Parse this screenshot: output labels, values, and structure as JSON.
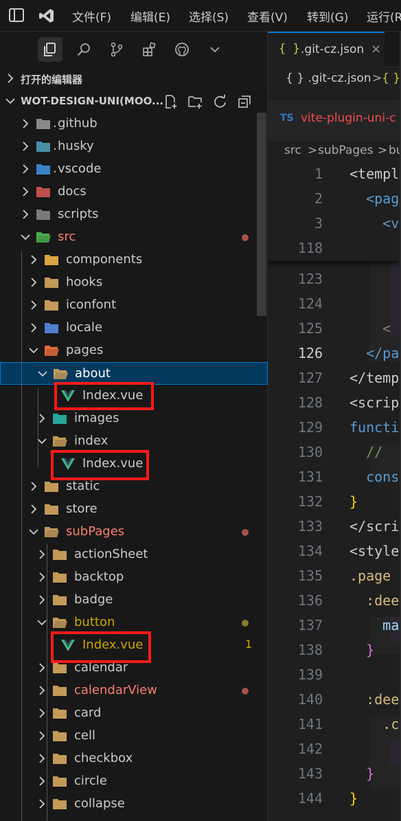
{
  "menu": {
    "items": [
      "文件(F)",
      "编辑(E)",
      "选择(S)",
      "查看(V)",
      "转到(G)",
      "运行(R)"
    ]
  },
  "activity_icons": [
    "explorer-icon",
    "search-icon",
    "source-control-icon",
    "extensions-icon",
    "github-icon",
    "chevron-down-icon"
  ],
  "explorer": {
    "open_editors_label": "打开的编辑器",
    "project_label": "WOT-DESIGN-UNI(MOO...",
    "rows": [
      {
        "label": "github",
        "prefix": ".",
        "depth": 0,
        "expanded": false,
        "icon": "github-folder-icon",
        "color": "#cccccc"
      },
      {
        "label": "husky",
        "prefix": ".",
        "depth": 0,
        "expanded": false,
        "icon": "husky-folder-icon",
        "color": "#cccccc"
      },
      {
        "label": "vscode",
        "prefix": ".",
        "depth": 0,
        "expanded": false,
        "icon": "vscode-folder-icon",
        "color": "#cccccc"
      },
      {
        "label": "docs",
        "prefix": "",
        "depth": 0,
        "expanded": false,
        "icon": "docs-folder-icon",
        "color": "#cccccc"
      },
      {
        "label": "scripts",
        "prefix": "",
        "depth": 0,
        "expanded": false,
        "icon": "scripts-folder-icon",
        "color": "#cccccc"
      },
      {
        "label": "src",
        "prefix": "",
        "depth": 0,
        "expanded": true,
        "icon": "src-folder-icon",
        "color": "#f88070",
        "dot": "#a4524a"
      },
      {
        "label": "components",
        "prefix": "",
        "depth": 1,
        "expanded": false,
        "icon": "components-folder-icon",
        "color": "#cccccc"
      },
      {
        "label": "hooks",
        "prefix": "",
        "depth": 1,
        "expanded": false,
        "icon": "hooks-folder-icon",
        "color": "#cccccc"
      },
      {
        "label": "iconfont",
        "prefix": "",
        "depth": 1,
        "expanded": false,
        "icon": "folder-icon",
        "color": "#cccccc"
      },
      {
        "label": "locale",
        "prefix": "",
        "depth": 1,
        "expanded": false,
        "icon": "locale-folder-icon",
        "color": "#cccccc"
      },
      {
        "label": "pages",
        "prefix": "",
        "depth": 1,
        "expanded": true,
        "icon": "pages-folder-icon",
        "color": "#cccccc"
      },
      {
        "label": "about",
        "prefix": "",
        "depth": 2,
        "expanded": true,
        "icon": "folder-open-icon",
        "color": "#ffffff",
        "selected": true
      },
      {
        "label": "Index.vue",
        "prefix": "",
        "depth": 3,
        "file": true,
        "icon": "vue-file-icon",
        "color": "#cccccc",
        "boxed": true
      },
      {
        "label": "images",
        "prefix": "",
        "depth": 2,
        "expanded": false,
        "icon": "images-folder-icon",
        "color": "#cccccc"
      },
      {
        "label": "index",
        "prefix": "",
        "depth": 2,
        "expanded": true,
        "icon": "folder-open-icon",
        "color": "#cccccc"
      },
      {
        "label": "Index.vue",
        "prefix": "",
        "depth": 3,
        "file": true,
        "icon": "vue-file-icon",
        "color": "#cccccc",
        "boxed": true
      },
      {
        "label": "static",
        "prefix": "",
        "depth": 1,
        "expanded": false,
        "icon": "folder-icon",
        "color": "#cccccc"
      },
      {
        "label": "store",
        "prefix": "",
        "depth": 1,
        "expanded": false,
        "icon": "folder-icon",
        "color": "#cccccc"
      },
      {
        "label": "subPages",
        "prefix": "",
        "depth": 1,
        "expanded": true,
        "icon": "folder-open-icon",
        "color": "#f88070",
        "dot": "#a4524a"
      },
      {
        "label": "actionSheet",
        "prefix": "",
        "depth": 2,
        "expanded": false,
        "icon": "folder-icon",
        "color": "#cccccc"
      },
      {
        "label": "backtop",
        "prefix": "",
        "depth": 2,
        "expanded": false,
        "icon": "folder-icon",
        "color": "#cccccc"
      },
      {
        "label": "badge",
        "prefix": "",
        "depth": 2,
        "expanded": false,
        "icon": "folder-icon",
        "color": "#cccccc"
      },
      {
        "label": "button",
        "prefix": "",
        "depth": 2,
        "expanded": true,
        "icon": "folder-open-icon",
        "color": "#cca700",
        "dot": "#8a7a2e"
      },
      {
        "label": "Index.vue",
        "prefix": "",
        "depth": 3,
        "file": true,
        "icon": "vue-file-icon",
        "color": "#cca700",
        "boxed": true,
        "badge": "1"
      },
      {
        "label": "calendar",
        "prefix": "",
        "depth": 2,
        "expanded": false,
        "icon": "folder-icon",
        "color": "#cccccc"
      },
      {
        "label": "calendarView",
        "prefix": "",
        "depth": 2,
        "expanded": false,
        "icon": "folder-icon",
        "color": "#f88070",
        "dot": "#a4524a"
      },
      {
        "label": "card",
        "prefix": "",
        "depth": 2,
        "expanded": false,
        "icon": "folder-icon",
        "color": "#cccccc"
      },
      {
        "label": "cell",
        "prefix": "",
        "depth": 2,
        "expanded": false,
        "icon": "folder-icon",
        "color": "#cccccc"
      },
      {
        "label": "checkbox",
        "prefix": "",
        "depth": 2,
        "expanded": false,
        "icon": "folder-icon",
        "color": "#cccccc"
      },
      {
        "label": "circle",
        "prefix": "",
        "depth": 2,
        "expanded": false,
        "icon": "folder-icon",
        "color": "#cccccc"
      },
      {
        "label": "collapse",
        "prefix": "",
        "depth": 2,
        "expanded": false,
        "icon": "folder-icon",
        "color": "#cccccc"
      }
    ]
  },
  "editor": {
    "tab_icon": "{ }",
    "tab_title": ".git-cz.json",
    "tab_close": "×",
    "breadcrumb": [
      "{ } .git-cz.json",
      ">",
      "{ }"
    ],
    "peek_lang": "TS",
    "peek_title": "vite-plugin-uni-c",
    "peek_breadcrumb": [
      "src",
      ">",
      "subPages",
      ">",
      "bu"
    ],
    "peek_lines": [
      {
        "n": "1",
        "text": "<templ",
        "color": "#cccccc"
      },
      {
        "n": "2",
        "text": "  <pag",
        "color": "#569cd6"
      },
      {
        "n": "3",
        "text": "    <v",
        "color": "#569cd6"
      },
      {
        "n": "118",
        "text": "",
        "color": "#cccccc"
      }
    ],
    "lines": [
      {
        "n": "123",
        "text": "",
        "color": "#cccccc"
      },
      {
        "n": "124",
        "text": "",
        "color": "#cccccc"
      },
      {
        "n": "125",
        "text": "    <",
        "color": "#808080"
      },
      {
        "n": "126",
        "text": "  </pa",
        "color": "#569cd6",
        "current": true
      },
      {
        "n": "127",
        "text": "</temp",
        "color": "#cccccc"
      },
      {
        "n": "128",
        "text": "<scrip",
        "color": "#cccccc"
      },
      {
        "n": "129",
        "text": "functi",
        "color": "#569cd6"
      },
      {
        "n": "130",
        "text": "  // ",
        "color": "#6a9955"
      },
      {
        "n": "131",
        "text": "  cons",
        "color": "#569cd6"
      },
      {
        "n": "132",
        "text": "}",
        "color": "#ffd700"
      },
      {
        "n": "133",
        "text": "</scri",
        "color": "#cccccc"
      },
      {
        "n": "134",
        "text": "<style",
        "color": "#cccccc"
      },
      {
        "n": "135",
        "text": ".page",
        "color": "#d7ba7d"
      },
      {
        "n": "136",
        "text": "  :dee",
        "color": "#d7ba7d"
      },
      {
        "n": "137",
        "text": "    ma",
        "color": "#9cdcfe"
      },
      {
        "n": "138",
        "text": "  }",
        "color": "#da70d6"
      },
      {
        "n": "139",
        "text": "",
        "color": "#cccccc"
      },
      {
        "n": "140",
        "text": "  :dee",
        "color": "#d7ba7d"
      },
      {
        "n": "141",
        "text": "    .c",
        "color": "#d7ba7d"
      },
      {
        "n": "142",
        "text": "",
        "color": "#cccccc"
      },
      {
        "n": "143",
        "text": "  }",
        "color": "#da70d6"
      },
      {
        "n": "144",
        "text": "}",
        "color": "#ffd700"
      }
    ]
  }
}
